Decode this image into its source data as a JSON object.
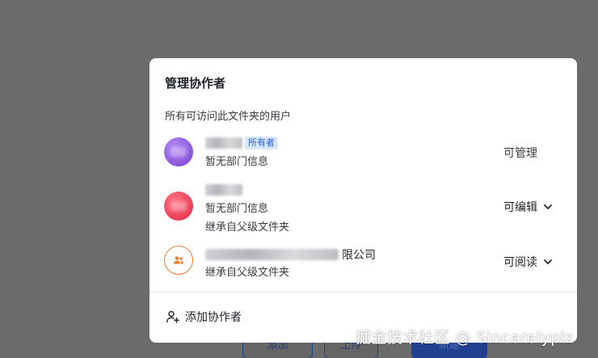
{
  "background": {
    "buttons": [
      {
        "label": "添加"
      },
      {
        "label": "上传"
      },
      {
        "label": "新建"
      }
    ]
  },
  "dialog": {
    "title": "管理协作者",
    "subtitle": "所有可访问此文件夹的用户",
    "members": [
      {
        "owner_tag": "所有者",
        "dept": "暂无部门信息",
        "permission": "可管理"
      },
      {
        "dept": "暂无部门信息",
        "inherit": "继承自父级文件夹",
        "permission": "可编辑"
      },
      {
        "org_suffix": "限公司",
        "inherit": "继承自父级文件夹",
        "permission": "可阅读"
      }
    ],
    "add_label": "添加协作者"
  },
  "watermark": "掘金技术社区 @ Sincerelyplz",
  "colors": {
    "overlay": "#6b6b6b",
    "owner_tag_bg": "#d9e6ff",
    "owner_tag_text": "#245bdb",
    "dept_icon": "#ed7b2f"
  }
}
